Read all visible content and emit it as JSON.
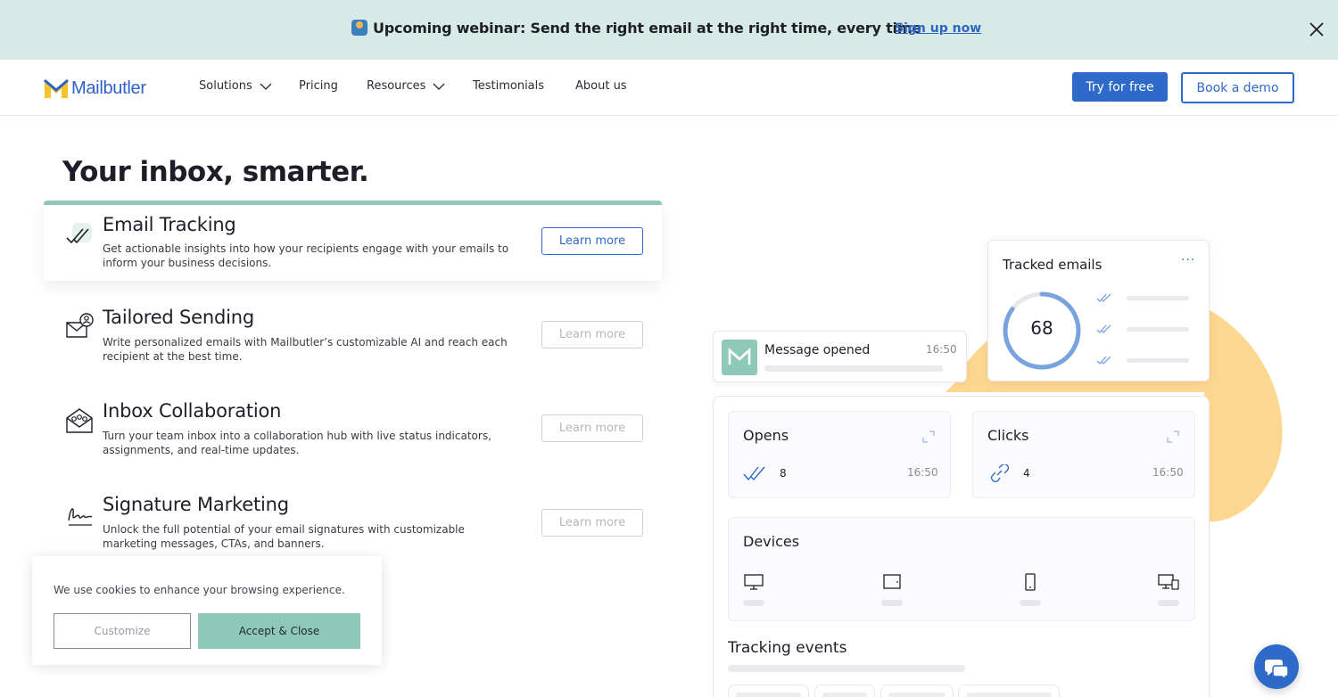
{
  "banner": {
    "emoji_icon": "person-at-laptop-icon",
    "text": "Upcoming webinar: Send the right email at the right time, every time",
    "link": "Sign up now"
  },
  "header": {
    "logo_text": "Mailbutler",
    "nav": [
      {
        "label": "Solutions",
        "dropdown": true
      },
      {
        "label": "Pricing",
        "dropdown": false
      },
      {
        "label": "Resources",
        "dropdown": true
      },
      {
        "label": "Testimonials",
        "dropdown": false
      },
      {
        "label": "About us",
        "dropdown": false
      }
    ],
    "try_label": "Try for free",
    "demo_label": "Book a demo"
  },
  "hero": {
    "title": "Your inbox, smarter."
  },
  "features": [
    {
      "title": "Email Tracking",
      "desc": "Get actionable insights into how your recipients engage with your emails to inform your business decisions.",
      "button": "Learn more",
      "icon": "double-check-icon",
      "active": true
    },
    {
      "title": "Tailored Sending",
      "desc": "Write personalized emails with Mailbutler’s customizable AI and reach each recipient at the best time.",
      "button": "Learn more",
      "icon": "envelope-person-icon",
      "active": false
    },
    {
      "title": "Inbox Collaboration",
      "desc": "Turn your team inbox into a collaboration hub with live status indicators, assignments, and real-time updates.",
      "button": "Learn more",
      "icon": "envelope-team-icon",
      "active": false
    },
    {
      "title": "Signature Marketing",
      "desc": "Unlock the full potential of your email signatures with customizable marketing messages, CTAs, and banners.",
      "button": "Learn more",
      "icon": "signature-icon",
      "active": false
    }
  ],
  "cookie": {
    "text": "We use cookies to enhance your browsing experience.",
    "customize": "Customize",
    "accept": "Accept & Close"
  },
  "dashboard": {
    "message": {
      "title": "Message opened",
      "time": "16:50"
    },
    "tracked": {
      "title": "Tracked emails",
      "more": "···",
      "count": "68",
      "progress": 0.85
    },
    "opens": {
      "title": "Opens",
      "value": "8",
      "time": "16:50"
    },
    "clicks": {
      "title": "Clicks",
      "value": "4",
      "time": "16:50"
    },
    "devices": {
      "title": "Devices",
      "icons": [
        "desktop-icon",
        "tablet-icon",
        "phone-icon",
        "multi-device-icon"
      ]
    },
    "events": {
      "title": "Tracking events"
    }
  },
  "colors": {
    "brand_blue": "#2e6ac9",
    "mint": "#8ec8b8",
    "banner_bg": "#d8eae5",
    "blob": "#fdd68f"
  }
}
